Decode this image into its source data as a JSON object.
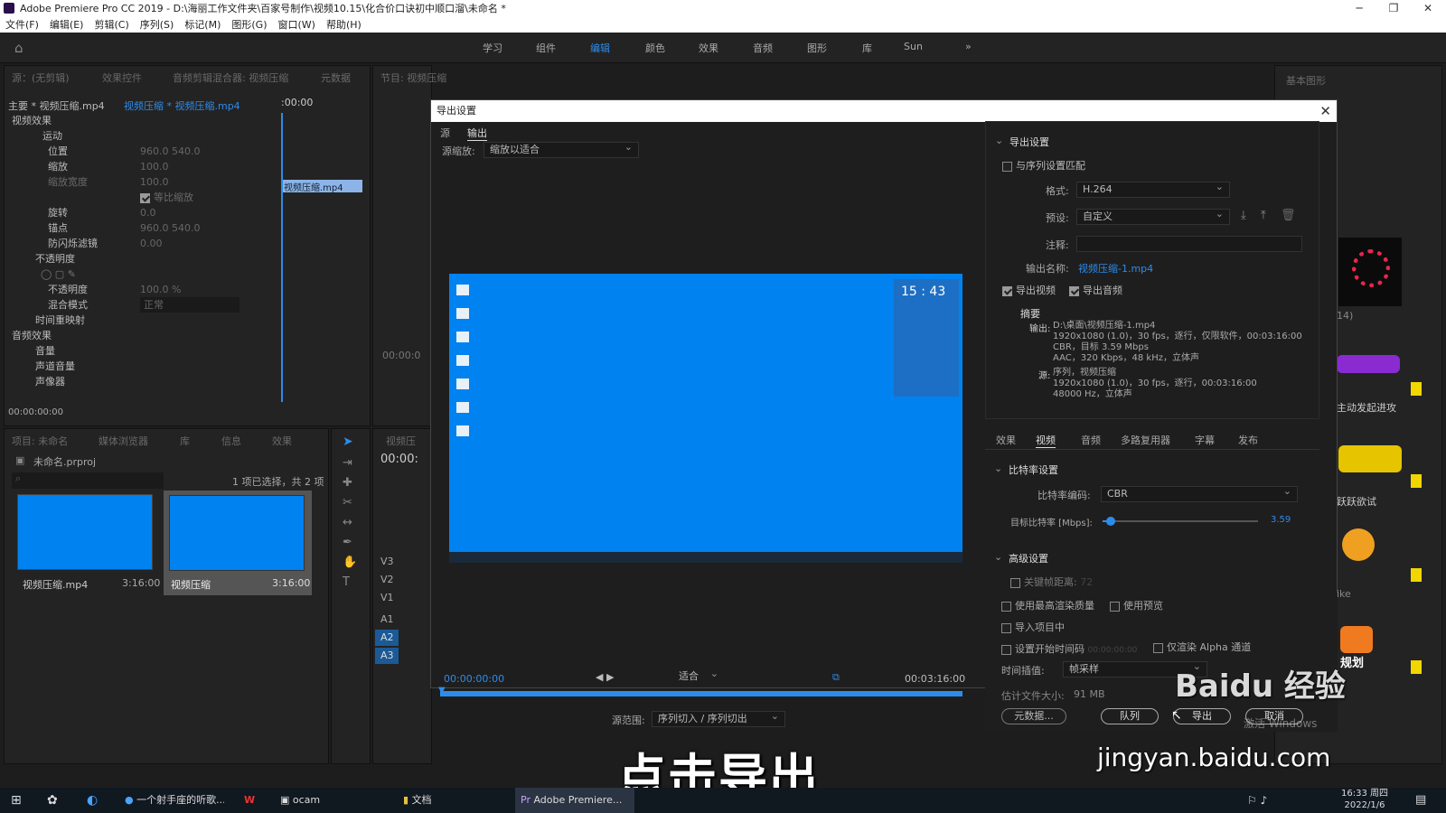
{
  "window": {
    "title": "Adobe Premiere Pro CC 2019 - D:\\海丽工作文件夹\\百家号制作\\视频10.15\\化合价口诀初中顺口溜\\未命名 *"
  },
  "menu": [
    "文件(F)",
    "编辑(E)",
    "剪辑(C)",
    "序列(S)",
    "标记(M)",
    "图形(G)",
    "窗口(W)",
    "帮助(H)"
  ],
  "workspaces": [
    "学习",
    "组件",
    "编辑",
    "颜色",
    "效果",
    "音频",
    "图形",
    "库",
    "Sun"
  ],
  "colors": {
    "accent": "#2d8ceb",
    "preview_bg": "#0082f0"
  },
  "effect_controls": {
    "tabs": [
      "源：(无剪辑)",
      "效果控件",
      "音频剪辑混合器: 视频压缩",
      "元数据"
    ],
    "master": "主要 * 视频压缩.mp4",
    "clip": "视频压缩 * 视频压缩.mp4",
    "timecode_head": ":00:00",
    "clip_bar": "视频压缩.mp4",
    "video_effects": "视频效果",
    "motion": "运动",
    "position": "位置",
    "position_val": "960.0   540.0",
    "scale": "缩放",
    "scale_val": "100.0",
    "scale_width": "缩放宽度",
    "scale_width_val": "100.0",
    "uniform_scale": "等比缩放",
    "rotation": "旋转",
    "rotation_val": "0.0",
    "anchor": "锚点",
    "anchor_val": "960.0   540.0",
    "anti_flicker": "防闪烁滤镜",
    "anti_flicker_val": "0.00",
    "opacity_group": "不透明度",
    "opacity": "不透明度",
    "opacity_val": "100.0 %",
    "blend": "混合模式",
    "blend_val": "正常",
    "time_remap": "时间重映射",
    "audio_effects": "音频效果",
    "volume": "音量",
    "channel_volume": "声道音量",
    "panner": "声像器",
    "bottom_time": "00:00:00:00"
  },
  "program": {
    "tab": "节目: 视频压缩",
    "time": "00:00:0"
  },
  "project": {
    "tabs": [
      "项目: 未命名",
      "媒体浏览器",
      "库",
      "信息",
      "效果"
    ],
    "file": "未命名.prproj",
    "count": "1 项已选择，共 2 项",
    "items": [
      {
        "name": "视频压缩.mp4",
        "dur": "3:16:00"
      },
      {
        "name": "视频压缩",
        "dur": "3:16:00"
      }
    ]
  },
  "timeline": {
    "tab": "视频压",
    "time": "00:00:",
    "tracks_v": [
      "V3",
      "V2",
      "V1"
    ],
    "tracks_a": [
      "A1",
      "A2",
      "A3"
    ]
  },
  "dialog": {
    "title": "导出设置",
    "tab_source": "源",
    "tab_output": "输出",
    "source_scaling_label": "源缩放:",
    "source_scaling": "缩放以适合",
    "preview_clock": "15 : 43",
    "time_in": "00:00:00:00",
    "fit": "适合",
    "time_out": "00:03:16:00",
    "source_range_label": "源范围:",
    "source_range": "序列切入 / 序列切出",
    "export_settings": "导出设置",
    "match_sequence": "与序列设置匹配",
    "format_label": "格式:",
    "format": "H.264",
    "preset_label": "预设:",
    "preset": "自定义",
    "comment_label": "注释:",
    "output_name_label": "输出名称:",
    "output_name": "视频压缩-1.mp4",
    "export_video": "导出视频",
    "export_audio": "导出音频",
    "summary": "摘要",
    "out_label": "输出:",
    "out_lines": [
      "D:\\桌面\\视频压缩-1.mp4",
      "1920x1080 (1.0)，30 fps，逐行，仅限软件，00:03:16:00",
      "CBR，目标 3.59 Mbps",
      "AAC，320 Kbps，48 kHz，立体声"
    ],
    "src_label": "源:",
    "src_lines": [
      "序列，视频压缩",
      "1920x1080 (1.0)，30 fps，逐行，00:03:16:00",
      "48000 Hz，立体声"
    ],
    "tabs": [
      "效果",
      "视频",
      "音频",
      "多路复用器",
      "字幕",
      "发布"
    ],
    "bitrate_header": "比特率设置",
    "bitrate_enc_label": "比特率编码:",
    "bitrate_enc": "CBR",
    "target_label": "目标比特率 [Mbps]:",
    "target_val": "3.59",
    "target_fraction": 0.05,
    "advanced": "高级设置",
    "keyframe": "关键帧距离:",
    "keyframe_val": "72",
    "max_render": "使用最高渲染质量",
    "use_preview": "使用预览",
    "import_project": "导入项目中",
    "start_tc": "设置开始时间码",
    "start_tc_val": "00:00:00:00",
    "alpha": "仅渲染 Alpha 通道",
    "interp_label": "时间插值:",
    "interp": "帧采样",
    "est_size_label": "估计文件大小:",
    "est_size": "91 MB",
    "metadata_btn": "元数据...",
    "queue_btn": "队列",
    "export_btn": "导出",
    "cancel_btn": "取消"
  },
  "right_panel": {
    "tab": "基本图形",
    "label1": "14)",
    "label2": "主动发起进攻",
    "label3": "跃跃欲试",
    "label4": "ike",
    "label5": "规划"
  },
  "taskbar": {
    "items": [
      "一个射手座的听歌...",
      "ocam",
      "文档",
      "Adobe Premiere..."
    ],
    "time": "16:33 周四",
    "date": "2022/1/6"
  },
  "watermark": {
    "brand": "Baidu 经验",
    "url": "jingyan.baidu.com",
    "windows": "激活 Windows"
  },
  "caption": "点击导出"
}
